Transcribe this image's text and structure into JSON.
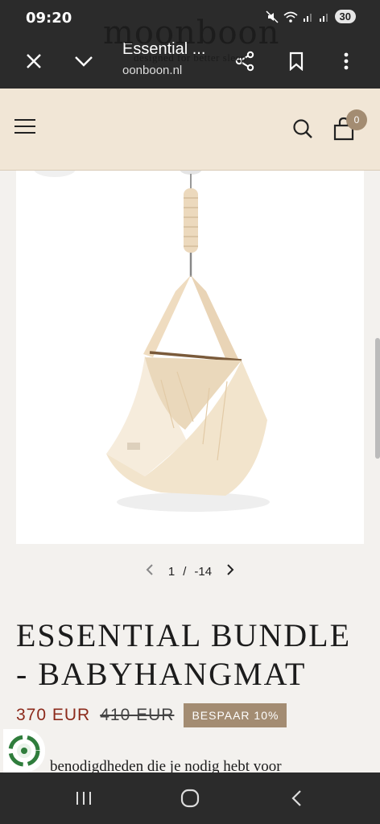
{
  "status": {
    "time": "09:20",
    "battery": "30"
  },
  "browser": {
    "title": "Essential ...",
    "url": "oonboon.nl"
  },
  "site": {
    "logo": "moonboon",
    "tagline": "designed for better sleep",
    "cart_count": "0"
  },
  "gallery": {
    "current": "1",
    "separator": "/",
    "total": "-14"
  },
  "product": {
    "title": "ESSENTIAL BUNDLE - BABYHANGMAT",
    "price": "370 EUR",
    "old_price": "410 EUR",
    "save_label": "BESPAAR 10%",
    "description_visible": "benodigdheden die je nodig hebt voor"
  },
  "colors": {
    "accent": "#a38c72",
    "price": "#8c2a1b",
    "header_bg": "#f1e6d6",
    "chrome": "#2b2b2b"
  },
  "icons": [
    "close-icon",
    "chevron-down-icon",
    "share-icon",
    "bookmark-icon",
    "more-vert-icon",
    "menu-icon",
    "search-icon",
    "cart-icon",
    "recycle-badge-icon",
    "recents-icon",
    "home-icon",
    "back-icon"
  ]
}
